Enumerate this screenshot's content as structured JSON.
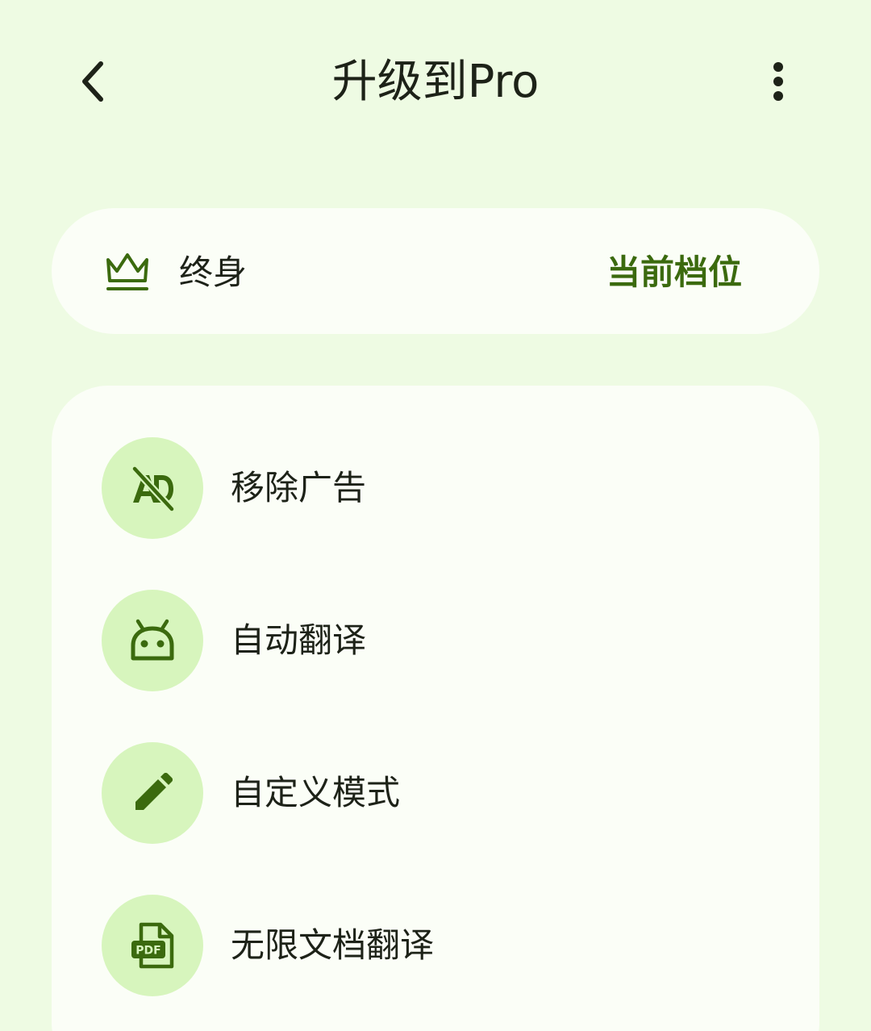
{
  "header": {
    "title": "升级到Pro"
  },
  "tier": {
    "label": "终身",
    "status": "当前档位"
  },
  "features": [
    {
      "label": "移除广告",
      "icon": "ad-off-icon"
    },
    {
      "label": "自动翻译",
      "icon": "android-icon"
    },
    {
      "label": "自定义模式",
      "icon": "pencil-icon"
    },
    {
      "label": "无限文档翻译",
      "icon": "pdf-icon"
    }
  ],
  "icon_text": {
    "pdf": "PDF"
  },
  "colors": {
    "background": "#eefbe3",
    "card": "#fbfef7",
    "accent": "#3b6a0e",
    "icon_circle": "#d7f5bd",
    "text": "#1d2218"
  }
}
